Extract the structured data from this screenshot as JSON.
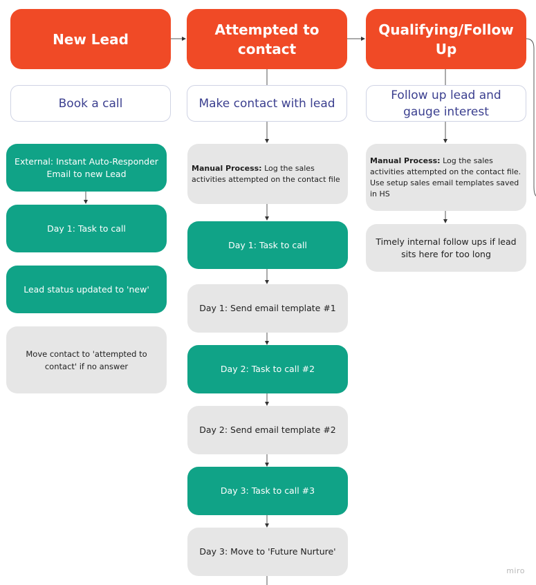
{
  "colors": {
    "header": "#f04a26",
    "action": "#10a387",
    "note": "#e6e6e6",
    "subtitle_text": "#3b3f8f"
  },
  "columns": [
    {
      "header": "New Lead",
      "subtitle": "Book a call",
      "steps": [
        {
          "type": "action",
          "text": "External: Instant Auto-Responder Email to new Lead"
        },
        {
          "type": "action",
          "text": "Day 1: Task to call"
        },
        {
          "type": "action",
          "text": "Lead status updated to 'new'"
        },
        {
          "type": "note",
          "text": "Move contact to 'attempted to contact' if no answer"
        }
      ]
    },
    {
      "header": "Attempted to contact",
      "subtitle": "Make contact with lead",
      "steps": [
        {
          "type": "note",
          "bold": "Manual Process:",
          "text": " Log the sales activities attempted on the contact file"
        },
        {
          "type": "action",
          "text": "Day 1: Task to call"
        },
        {
          "type": "note",
          "text": "Day 1: Send email template #1"
        },
        {
          "type": "action",
          "text": "Day 2: Task to call #2"
        },
        {
          "type": "note",
          "text": "Day 2: Send email template #2"
        },
        {
          "type": "action",
          "text": "Day 3: Task to call #3"
        },
        {
          "type": "note",
          "text": "Day 3: Move to 'Future Nurture'"
        }
      ]
    },
    {
      "header": "Qualifying/Follow Up",
      "subtitle": "Follow up lead and gauge interest",
      "steps": [
        {
          "type": "note",
          "bold": "Manual Process:",
          "text": " Log the sales activities attempted on the contact file. Use setup sales email templates saved in HS"
        },
        {
          "type": "note",
          "text": "Timely internal follow ups if lead sits here for too long"
        }
      ]
    }
  ],
  "watermark": "miro"
}
